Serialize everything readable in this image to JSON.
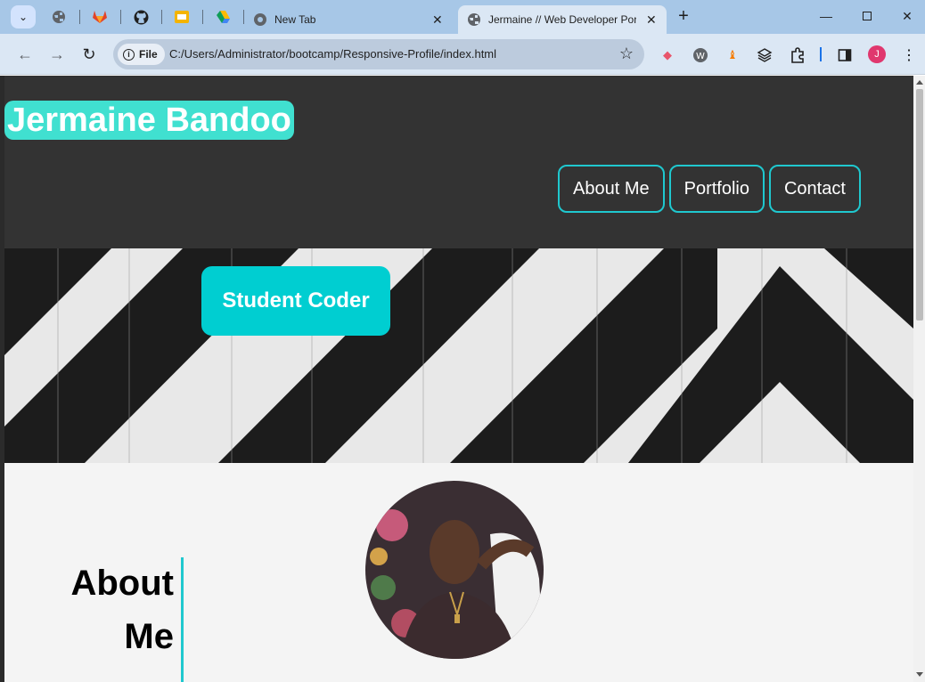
{
  "browser": {
    "tabs": [
      {
        "title": "New Tab"
      },
      {
        "title": "Jermaine // Web Developer Por"
      }
    ],
    "address": {
      "scheme_label": "File",
      "url": "C:/Users/Administrator/bootcamp/Responsive-Profile/index.html"
    },
    "profile_initial": "J"
  },
  "site": {
    "title": "Jermaine Bandoo",
    "nav": [
      "About Me",
      "Portfolio",
      "Contact"
    ],
    "hero_badge": "Student Coder",
    "about_heading_line1": "About",
    "about_heading_line2": "Me"
  },
  "colors": {
    "accent": "#40e0d0",
    "border_accent": "#1fc8cf",
    "header_bg": "#333333"
  }
}
